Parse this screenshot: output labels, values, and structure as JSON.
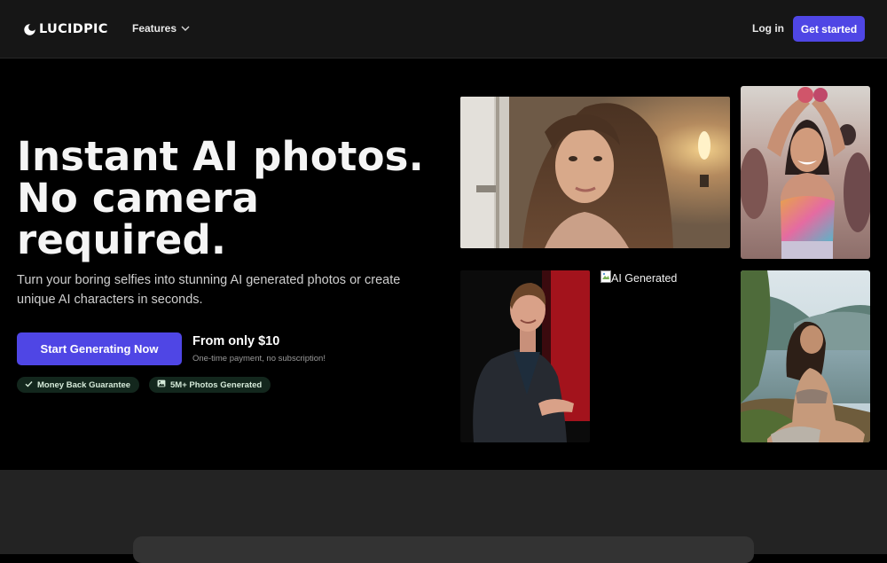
{
  "nav": {
    "brand": "LUCIDPIC",
    "features_label": "Features",
    "login_label": "Log in",
    "get_started_label": "Get started"
  },
  "hero": {
    "headline_line1": "Instant AI photos.",
    "headline_line2": "No camera",
    "headline_line3": "required.",
    "subline": "Turn your boring selfies into stunning AI generated photos or create unique AI characters in seconds.",
    "cta_label": "Start Generating Now",
    "price": "From only $10",
    "price_note": "One-time payment, no subscription!",
    "badges": [
      {
        "label": "Money Back Guarantee",
        "icon": "check-icon"
      },
      {
        "label": "5M+ Photos Generated",
        "icon": "image-icon"
      }
    ],
    "broken_image_alt": "AI Generated"
  },
  "colors": {
    "accent": "#4f46e5",
    "background": "#000000",
    "nav_background": "#161616",
    "badge_background": "#13271d"
  }
}
